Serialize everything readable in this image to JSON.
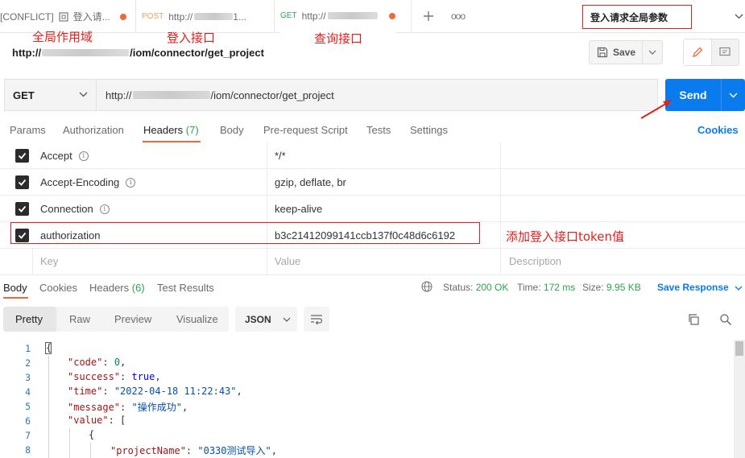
{
  "tabs": [
    {
      "prefix": "[CONFLICT]",
      "label": "登入请..."
    },
    {
      "method": "POST",
      "label": "http://"
    },
    {
      "method": "GET",
      "label": "http://"
    }
  ],
  "tab_label_trail": "1...",
  "tab_more": "ooo",
  "environment": "登入请求全局参数",
  "annotations": {
    "global_scope": "全局作用域",
    "login_api": "登入接口",
    "query_api": "查询接口",
    "add_token": "添加登入接口token值"
  },
  "request": {
    "title_prefix": "http://",
    "title_path": "/iom/connector/get_project",
    "method": "GET",
    "url_prefix": "http://",
    "url_path": "/iom/connector/get_project"
  },
  "toolbar": {
    "save_label": "Save"
  },
  "send_label": "Send",
  "request_tabs": {
    "params": "Params",
    "authorization": "Authorization",
    "headers": "Headers",
    "headers_count": "(7)",
    "body": "Body",
    "prerequest": "Pre-request Script",
    "tests": "Tests",
    "settings": "Settings",
    "cookies": "Cookies"
  },
  "headers": [
    {
      "key": "Accept",
      "value": "*/*"
    },
    {
      "key": "Accept-Encoding",
      "value": "gzip, deflate, br"
    },
    {
      "key": "Connection",
      "value": "keep-alive"
    },
    {
      "key": "authorization",
      "value": "b3c21412099141ccb137f0c48d6c6192"
    }
  ],
  "header_placeholders": {
    "key": "Key",
    "value": "Value",
    "description": "Description"
  },
  "response_tabs": {
    "body": "Body",
    "cookies": "Cookies",
    "headers": "Headers",
    "headers_count": "(6)",
    "test_results": "Test Results"
  },
  "response_status": {
    "status_label": "Status:",
    "status_value": "200 OK",
    "time_label": "Time:",
    "time_value": "172 ms",
    "size_label": "Size:",
    "size_value": "9.95 KB",
    "save_response": "Save Response"
  },
  "view_modes": {
    "pretty": "Pretty",
    "raw": "Raw",
    "preview": "Preview",
    "visualize": "Visualize"
  },
  "format": "JSON",
  "code": {
    "line_numbers": [
      "1",
      "2",
      "3",
      "4",
      "5",
      "6",
      "7",
      "8"
    ],
    "brace_open": "{",
    "code_key": "\"code\"",
    "code_val": "0",
    "success_key": "\"success\"",
    "success_val": "true",
    "time_key": "\"time\"",
    "time_val": "\"2022-04-18 11:22:43\"",
    "message_key": "\"message\"",
    "message_val": "\"操作成功\"",
    "value_key": "\"value\"",
    "value_open": "[",
    "obj_open": "{",
    "project_key": "\"projectName\"",
    "project_val": "\"0330测试导入\""
  },
  "colors": {
    "accent": "#097bed",
    "active_tab": "#ef6a3a",
    "annotation": "#e0201c"
  }
}
